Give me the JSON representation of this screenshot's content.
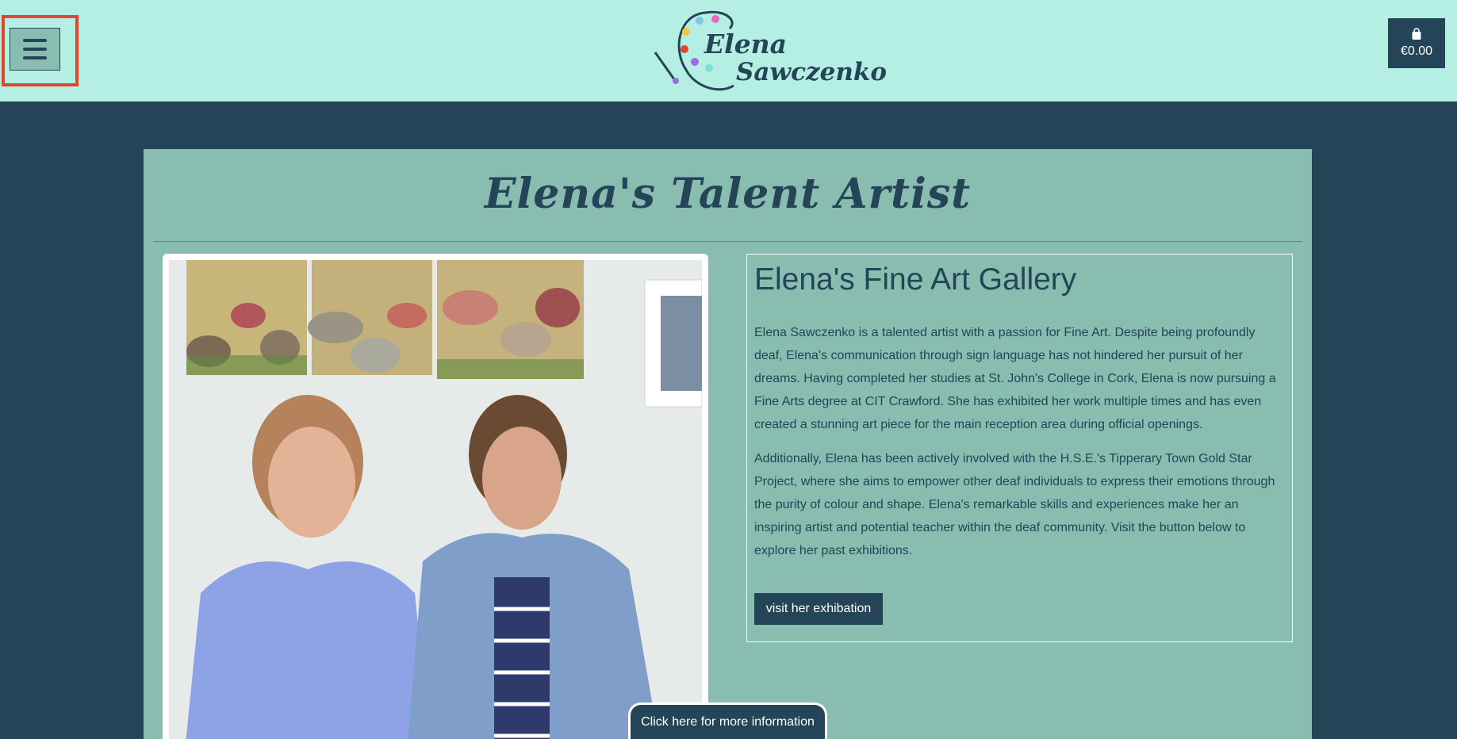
{
  "header": {
    "logo_first": "Elena",
    "logo_last": "Sawczenko",
    "cart_amount": "€0.00"
  },
  "main": {
    "page_title": "Elena's Talent Artist",
    "info": {
      "title": "Elena's Fine Art Gallery",
      "paragraph1": "Elena Sawczenko is a talented artist with a passion for Fine Art. Despite being profoundly deaf, Elena's communication through sign language has not hindered her pursuit of her dreams. Having completed her studies at St. John's College in Cork, Elena is now pursuing a Fine Arts degree at CIT Crawford. She has exhibited her work multiple times and has even created a stunning art piece for the main reception area during official openings.",
      "paragraph2": "Additionally, Elena has been actively involved with the H.S.E.'s Tipperary Town Gold Star Project, where she aims to empower other deaf individuals to express their emotions through the purity of colour and shape. Elena's remarkable skills and experiences make her an inspiring artist and potential teacher within the deaf community. Visit the button below to explore her past exhibitions.",
      "button_label": "visit her exhibation"
    }
  },
  "footer_tab": {
    "label": "Click here for more information"
  },
  "colors": {
    "header_bg": "#b5eee2",
    "page_bg": "#244457",
    "panel_bg": "#89bdb0",
    "highlight": "#e2452b"
  },
  "icons": [
    "menu-icon",
    "palette-logo-icon",
    "shopping-bag-icon"
  ]
}
